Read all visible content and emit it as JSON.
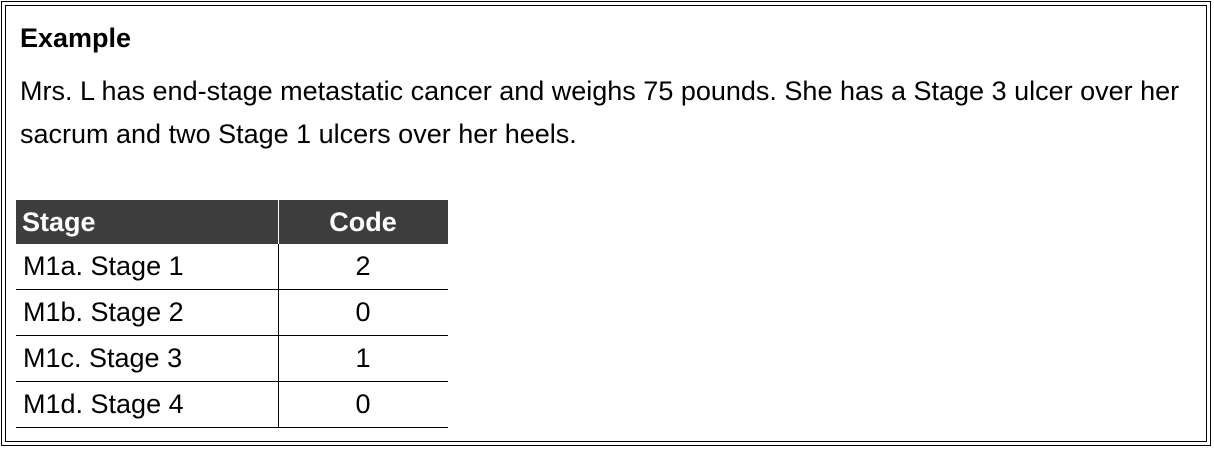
{
  "heading": "Example",
  "paragraph": "Mrs. L has end-stage metastatic cancer and weighs 75 pounds. She has a Stage 3 ulcer over her sacrum and two Stage 1 ulcers over her heels.",
  "table": {
    "headers": [
      "Stage",
      "Code"
    ],
    "rows": [
      {
        "stage": "M1a. Stage 1",
        "code": "2"
      },
      {
        "stage": "M1b. Stage 2",
        "code": "0"
      },
      {
        "stage": "M1c. Stage 3",
        "code": "1"
      },
      {
        "stage": "M1d. Stage 4",
        "code": "0"
      }
    ],
    "header_bg": "#3e3e3e",
    "header_text_color": "#ffffff"
  }
}
